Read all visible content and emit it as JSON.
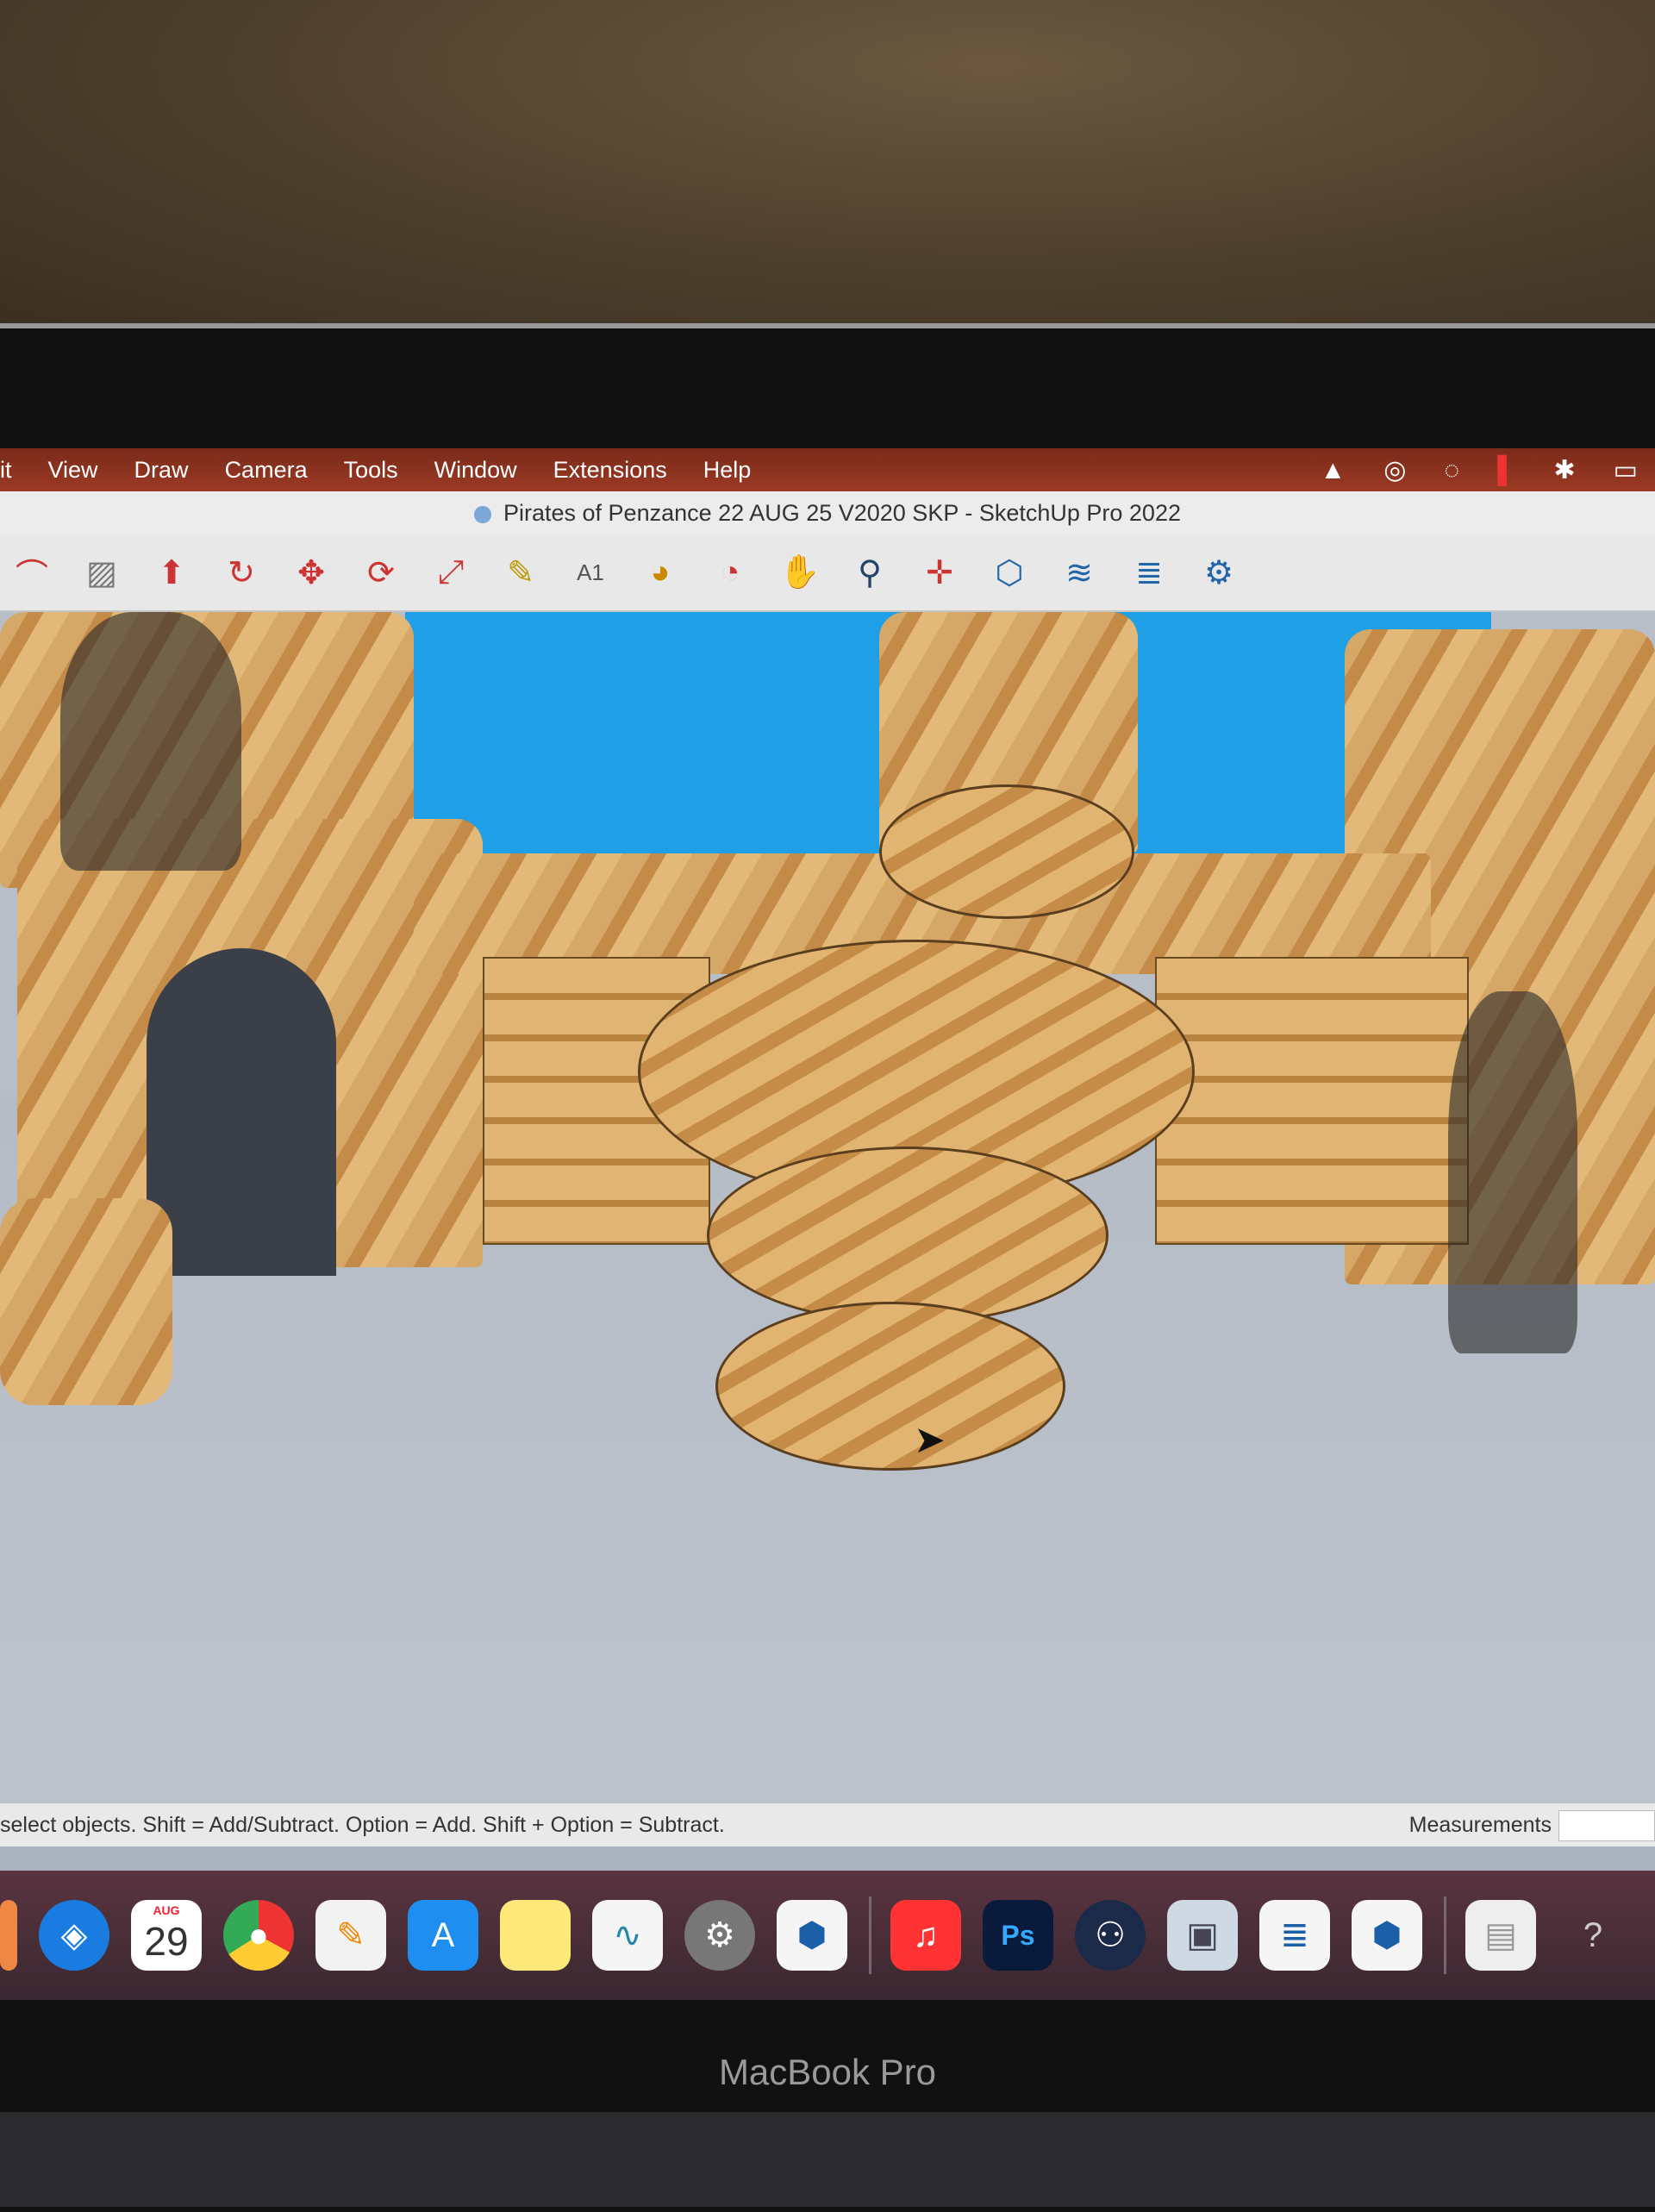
{
  "menubar": {
    "items": [
      "it",
      "View",
      "Draw",
      "Camera",
      "Tools",
      "Window",
      "Extensions",
      "Help"
    ]
  },
  "window": {
    "title": "Pirates of Penzance 22 AUG 25 V2020 SKP - SketchUp Pro 2022"
  },
  "toolbar": {
    "tools": [
      "arc-icon",
      "shape-icon",
      "push-pull-icon",
      "offset-icon",
      "move-icon",
      "rotate-icon",
      "scale-icon",
      "tape-measure-icon",
      "text-icon",
      "paint-bucket-icon",
      "orbit-icon",
      "pan-icon",
      "zoom-icon",
      "zoom-extents-icon",
      "warehouse-icon",
      "extension-warehouse-icon",
      "layout-icon",
      "extension-manager-icon"
    ]
  },
  "statusbar": {
    "message": "select objects. Shift = Add/Subtract. Option = Add. Shift + Option = Subtract.",
    "measurements_label": "Measurements"
  },
  "dock": {
    "calendar_month": "AUG",
    "calendar_day": "29",
    "photoshop_label": "Ps"
  },
  "device": {
    "brand": "MacBook Pro"
  }
}
